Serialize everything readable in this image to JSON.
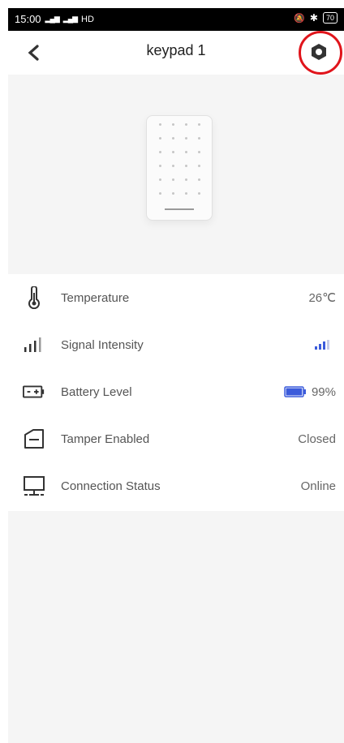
{
  "status_bar": {
    "time": "15:00",
    "network_1": "4G",
    "network_2": "4G",
    "network_label": "HD",
    "battery": "70"
  },
  "header": {
    "title": "keypad 1",
    "highlight_color": "#e0141b"
  },
  "device": {
    "image": "keypad-illustration"
  },
  "details": [
    {
      "icon": "thermometer-icon",
      "label": "Temperature",
      "value": "26℃"
    },
    {
      "icon": "signal-bars-icon",
      "label": "Signal Intensity",
      "value_icon": "signal-strength-icon",
      "signal_level": 3
    },
    {
      "icon": "battery-icon",
      "label": "Battery Level",
      "value": "99%",
      "battery_level": 0.99,
      "battery_color": "#3b5bdb"
    },
    {
      "icon": "tamper-icon",
      "label": "Tamper Enabled",
      "value": "Closed"
    },
    {
      "icon": "monitor-icon",
      "label": "Connection Status",
      "value": "Online"
    }
  ]
}
